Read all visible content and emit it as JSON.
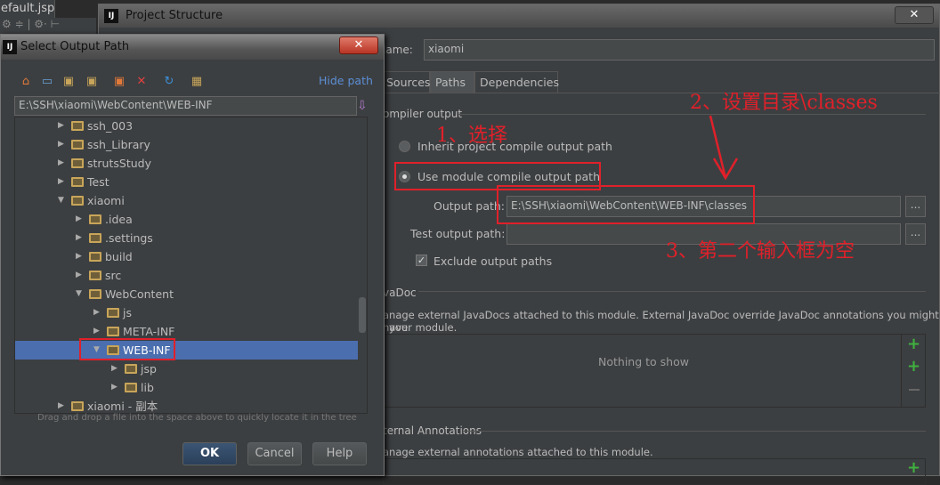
{
  "background_ide": {
    "tab": "efault.jsp",
    "toolbar": "⚙ ≑ | ⚙· ⊢"
  },
  "project_structure": {
    "title": "Project Structure",
    "close": "✕",
    "name_label": "lame:",
    "name_value": "xiaomi",
    "tabs": [
      {
        "label": "Sources"
      },
      {
        "label": "Paths",
        "selected": true
      },
      {
        "label": "Dependencies"
      }
    ],
    "compiler_output": {
      "title": "ompiler output",
      "inherit": "Inherit project compile output path",
      "use_module": "Use module compile output path",
      "selected": "use_module",
      "output_label": "Output path:",
      "output_value": "E:\\SSH\\xiaomi\\WebContent\\WEB-INF\\classes",
      "test_label": "Test output path:",
      "test_value": "",
      "browse": "...",
      "exclude": "Exclude output paths",
      "exclude_checked": true
    },
    "javadoc": {
      "title": "vaDoc",
      "desc1": "anage external JavaDocs attached to this module. External JavaDoc override JavaDoc annotations you might have",
      "desc2": "your module.",
      "empty": "Nothing to show"
    },
    "annotations": {
      "title": "ternal Annotations",
      "desc": "anage external annotations attached to this module."
    }
  },
  "dialog": {
    "title": "Select Output Path",
    "close": "✕",
    "hide_path": "Hide path",
    "path": "E:\\SSH\\xiaomi\\WebContent\\WEB-INF",
    "tree": [
      {
        "label": "ssh_003",
        "level": 1,
        "expanded": false
      },
      {
        "label": "ssh_Library",
        "level": 1,
        "expanded": false
      },
      {
        "label": "strutsStudy",
        "level": 1,
        "expanded": false
      },
      {
        "label": "Test",
        "level": 1,
        "expanded": false
      },
      {
        "label": "xiaomi",
        "level": 1,
        "expanded": true
      },
      {
        "label": ".idea",
        "level": 2,
        "expanded": false
      },
      {
        "label": ".settings",
        "level": 2,
        "expanded": false
      },
      {
        "label": "build",
        "level": 2,
        "expanded": false
      },
      {
        "label": "src",
        "level": 2,
        "expanded": false
      },
      {
        "label": "WebContent",
        "level": 2,
        "expanded": true
      },
      {
        "label": "js",
        "level": 3,
        "expanded": false
      },
      {
        "label": "META-INF",
        "level": 3,
        "expanded": false
      },
      {
        "label": "WEB-INF",
        "level": 3,
        "expanded": true,
        "selected": true
      },
      {
        "label": "jsp",
        "level": 4,
        "expanded": false
      },
      {
        "label": "lib",
        "level": 4,
        "expanded": false
      },
      {
        "label": "xiaomi - 副本",
        "level": 1,
        "expanded": false
      }
    ],
    "hint": "Drag and drop a file into the space above to quickly locate it in the tree",
    "ok": "OK",
    "cancel": "Cancel",
    "help": "Help"
  },
  "annotations": {
    "step1": "1、选择",
    "step2": "2、设置目录\\classes",
    "step3": "3、第二个输入框为空",
    "color": "#e0202a"
  }
}
